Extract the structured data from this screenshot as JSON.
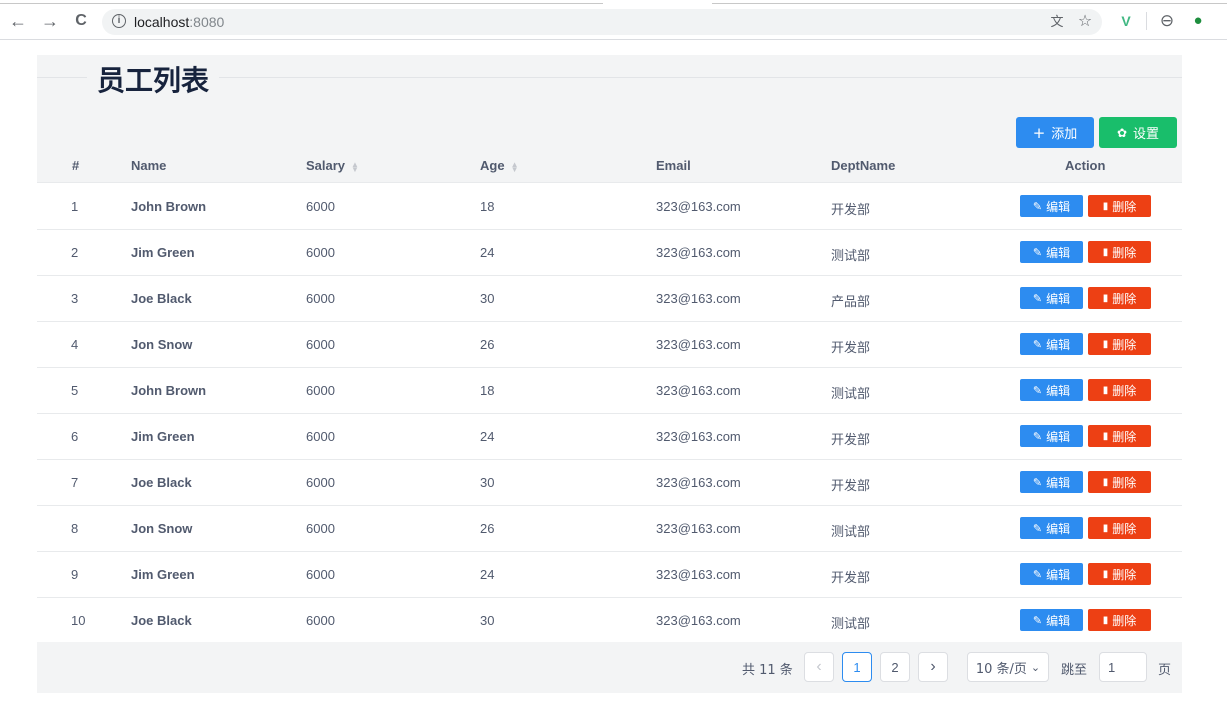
{
  "browser": {
    "back_icon": "←",
    "forward_icon": "→",
    "reload_icon": "C",
    "url_host": "localhost",
    "url_port": ":8080",
    "info_icon": "i",
    "translate_icon": "文",
    "star_icon": "☆",
    "vue_icon": "V",
    "account_icon": "⊖",
    "extension_icon": "●"
  },
  "page": {
    "title": "员工列表"
  },
  "toolbar": {
    "add_label": "添加",
    "add_icon": "+",
    "settings_label": "设置",
    "settings_icon": "✿"
  },
  "table": {
    "headers": {
      "index": "#",
      "name": "Name",
      "salary": "Salary",
      "age": "Age",
      "email": "Email",
      "dept": "DeptName",
      "action": "Action"
    },
    "sort_up": "▲",
    "sort_down": "▼",
    "edit_label": "编辑",
    "edit_icon": "✎",
    "delete_label": "删除",
    "delete_icon": "▮",
    "rows": [
      {
        "index": "1",
        "name": "John Brown",
        "salary": "6000",
        "age": "18",
        "email": "323@163.com",
        "dept": "开发部"
      },
      {
        "index": "2",
        "name": "Jim Green",
        "salary": "6000",
        "age": "24",
        "email": "323@163.com",
        "dept": "测试部"
      },
      {
        "index": "3",
        "name": "Joe Black",
        "salary": "6000",
        "age": "30",
        "email": "323@163.com",
        "dept": "产品部"
      },
      {
        "index": "4",
        "name": "Jon Snow",
        "salary": "6000",
        "age": "26",
        "email": "323@163.com",
        "dept": "开发部"
      },
      {
        "index": "5",
        "name": "John Brown",
        "salary": "6000",
        "age": "18",
        "email": "323@163.com",
        "dept": "测试部"
      },
      {
        "index": "6",
        "name": "Jim Green",
        "salary": "6000",
        "age": "24",
        "email": "323@163.com",
        "dept": "开发部"
      },
      {
        "index": "7",
        "name": "Joe Black",
        "salary": "6000",
        "age": "30",
        "email": "323@163.com",
        "dept": "开发部"
      },
      {
        "index": "8",
        "name": "Jon Snow",
        "salary": "6000",
        "age": "26",
        "email": "323@163.com",
        "dept": "测试部"
      },
      {
        "index": "9",
        "name": "Jim Green",
        "salary": "6000",
        "age": "24",
        "email": "323@163.com",
        "dept": "开发部"
      },
      {
        "index": "10",
        "name": "Joe Black",
        "salary": "6000",
        "age": "30",
        "email": "323@163.com",
        "dept": "测试部"
      }
    ]
  },
  "pagination": {
    "total": "共 11 条",
    "prev_icon": "‹",
    "next_icon": "›",
    "pages": [
      "1",
      "2"
    ],
    "current_page": "1",
    "page_size": "10 条/页",
    "page_size_icon": "⌄",
    "jump_label": "跳至",
    "jump_value": "1",
    "page_suffix": "页"
  },
  "colors": {
    "primary": "#2d8cf0",
    "success": "#19be6b",
    "error": "#ed4014"
  }
}
